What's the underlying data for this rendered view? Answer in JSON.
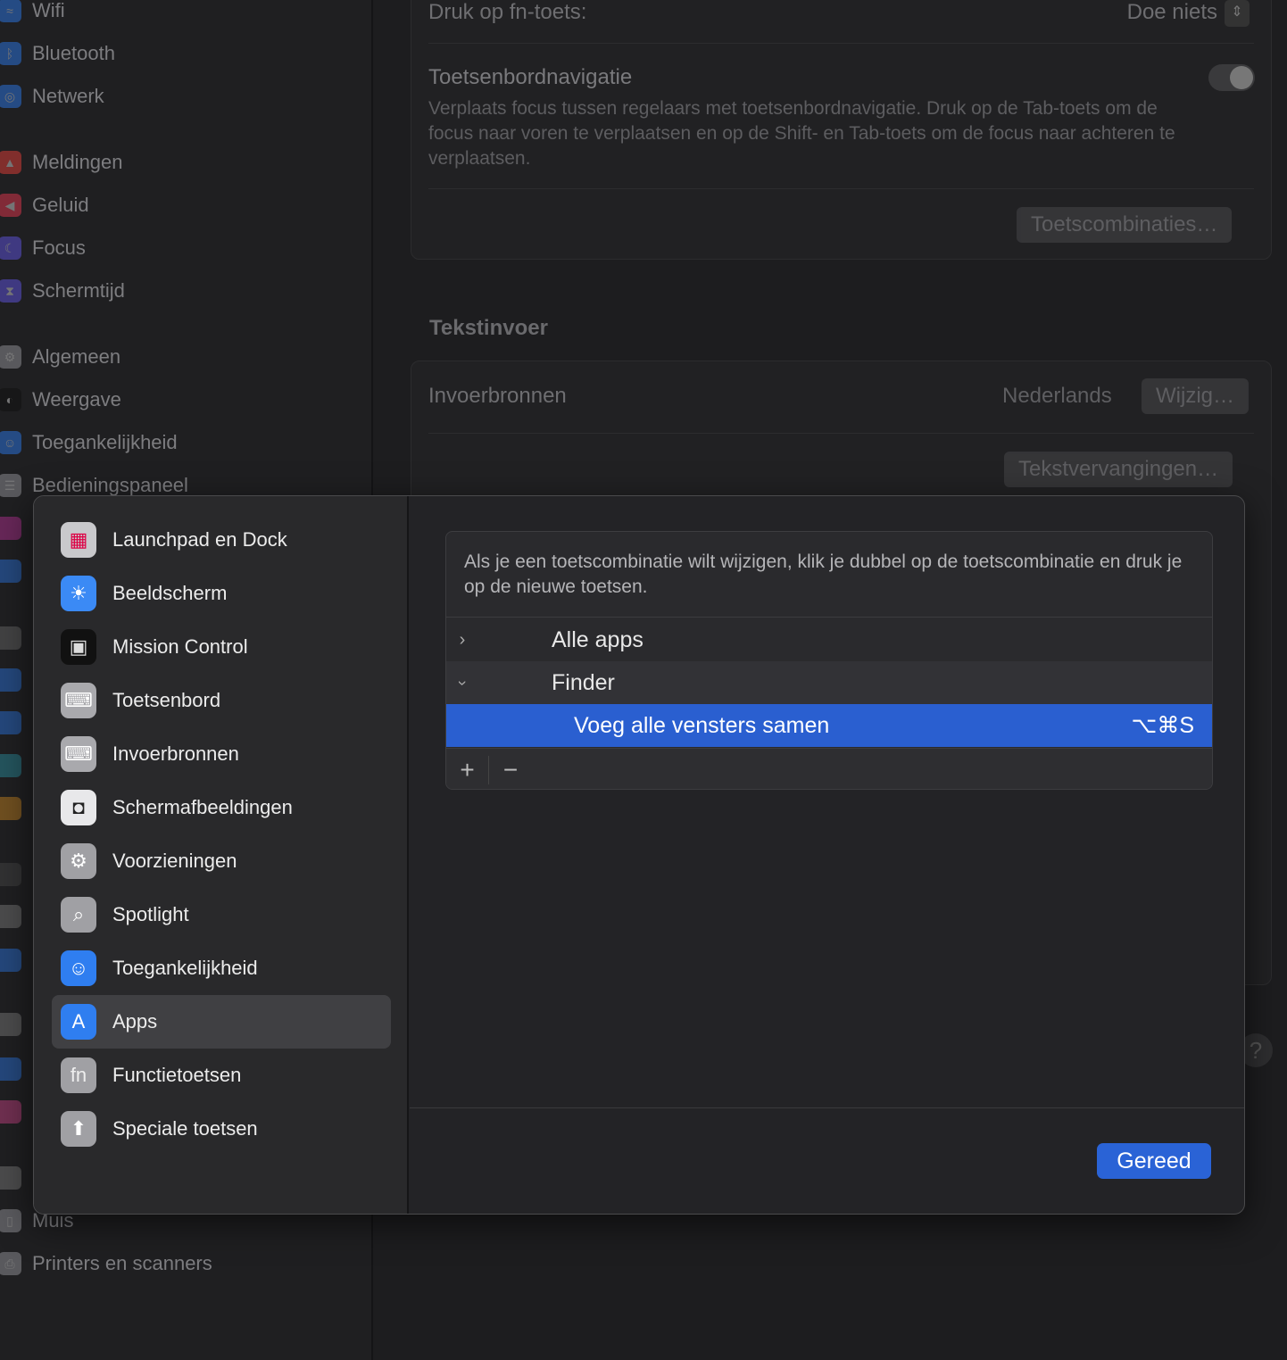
{
  "background": {
    "sidebar": [
      {
        "label": "Wifi",
        "icon": "wifi-icon",
        "color": "#2a6fd6",
        "glyph": "≈"
      },
      {
        "label": "Bluetooth",
        "icon": "bluetooth-icon",
        "color": "#2a6fd6",
        "glyph": "ᛒ"
      },
      {
        "label": "Netwerk",
        "icon": "globe-icon",
        "color": "#2a6fd6",
        "glyph": "◎"
      },
      {
        "label": "Meldingen",
        "icon": "bell-icon",
        "color": "#d23b36",
        "glyph": "▲"
      },
      {
        "label": "Geluid",
        "icon": "speaker-icon",
        "color": "#d2334a",
        "glyph": "◀"
      },
      {
        "label": "Focus",
        "icon": "moon-icon",
        "color": "#5a4fd0",
        "glyph": "☾"
      },
      {
        "label": "Schermtijd",
        "icon": "hourglass-icon",
        "color": "#5a4fd0",
        "glyph": "⧗"
      },
      {
        "label": "Algemeen",
        "icon": "gear-icon",
        "color": "#8a8a8e",
        "glyph": "⚙"
      },
      {
        "label": "Weergave",
        "icon": "appearance-icon",
        "color": "#111",
        "glyph": "◐"
      },
      {
        "label": "Toegankelijkheid",
        "icon": "accessibility-icon",
        "color": "#2a6fd6",
        "glyph": "☺"
      },
      {
        "label": "Bedieningspaneel",
        "icon": "control-center-icon",
        "color": "#8a8a8e",
        "glyph": "☰"
      }
    ],
    "sidebar_bottom": [
      {
        "label": "Muis",
        "icon": "mouse-icon",
        "color": "#8a8a8e",
        "glyph": "▯"
      },
      {
        "label": "Printers en scanners",
        "icon": "printer-icon",
        "color": "#8a8a8e",
        "glyph": "⎙"
      }
    ],
    "fn_label": "Druk op fn-toets:",
    "fn_value": "Doe niets",
    "nav_title": "Toetsenbordnavigatie",
    "nav_desc": "Verplaats focus tussen regelaars met toetsenbordnavigatie. Druk op de Tab-toets om de focus naar voren te verplaatsen en op de Shift- en Tab-toets om de focus naar achteren te verplaatsen.",
    "nav_toggle_on": false,
    "shortcuts_button": "Toetscombinaties…",
    "text_input_heading": "Tekstinvoer",
    "input_sources_label": "Invoerbronnen",
    "input_sources_value": "Nederlands",
    "change_button": "Wijzig…",
    "replacements_button": "Tekstvervangingen…",
    "help": "?"
  },
  "modal": {
    "sidebar": [
      {
        "label": "Launchpad en Dock",
        "icon": "launchpad-icon",
        "bg": "#c9c9cc",
        "glyph": "▦",
        "fg": "#d04"
      },
      {
        "label": "Beeldscherm",
        "icon": "sun-icon",
        "bg": "#3b8af5",
        "glyph": "☀",
        "fg": "#fff"
      },
      {
        "label": "Mission Control",
        "icon": "mission-control-icon",
        "bg": "#111",
        "glyph": "▣",
        "fg": "#ddd"
      },
      {
        "label": "Toetsenbord",
        "icon": "keyboard-icon",
        "bg": "#a9a9ad",
        "glyph": "⌨",
        "fg": "#fff"
      },
      {
        "label": "Invoerbronnen",
        "icon": "keyboard-icon",
        "bg": "#a9a9ad",
        "glyph": "⌨",
        "fg": "#fff"
      },
      {
        "label": "Schermafbeeldingen",
        "icon": "screenshot-icon",
        "bg": "#e8e8ea",
        "glyph": "◘",
        "fg": "#222"
      },
      {
        "label": "Voorzieningen",
        "icon": "gears-icon",
        "bg": "#a0a0a4",
        "glyph": "⚙",
        "fg": "#fff"
      },
      {
        "label": "Spotlight",
        "icon": "magnifier-icon",
        "bg": "#a0a0a4",
        "glyph": "⌕",
        "fg": "#fff"
      },
      {
        "label": "Toegankelijkheid",
        "icon": "accessibility-icon",
        "bg": "#2f7ef0",
        "glyph": "☺",
        "fg": "#fff"
      },
      {
        "label": "Apps",
        "icon": "app-store-icon",
        "bg": "#2f7ef0",
        "glyph": "A",
        "fg": "#fff"
      },
      {
        "label": "Functietoetsen",
        "icon": "fn-icon",
        "bg": "#a0a0a4",
        "glyph": "fn",
        "fg": "#eee"
      },
      {
        "label": "Speciale toetsen",
        "icon": "up-arrow-icon",
        "bg": "#a0a0a4",
        "glyph": "⬆",
        "fg": "#fff"
      }
    ],
    "selected_index": 9,
    "info": "Als je een toetscombinatie wilt wijzigen, klik je dubbel op de toetscombinatie en druk je op de nieuwe toetsen.",
    "groups": [
      {
        "label": "Alle apps",
        "expanded": false
      },
      {
        "label": "Finder",
        "expanded": true
      }
    ],
    "shortcut": {
      "label": "Voeg alle vensters samen",
      "keys": "⌥⌘S"
    },
    "add": "+",
    "remove": "−",
    "done_button": "Gereed",
    "accent": "#2a63d6"
  }
}
